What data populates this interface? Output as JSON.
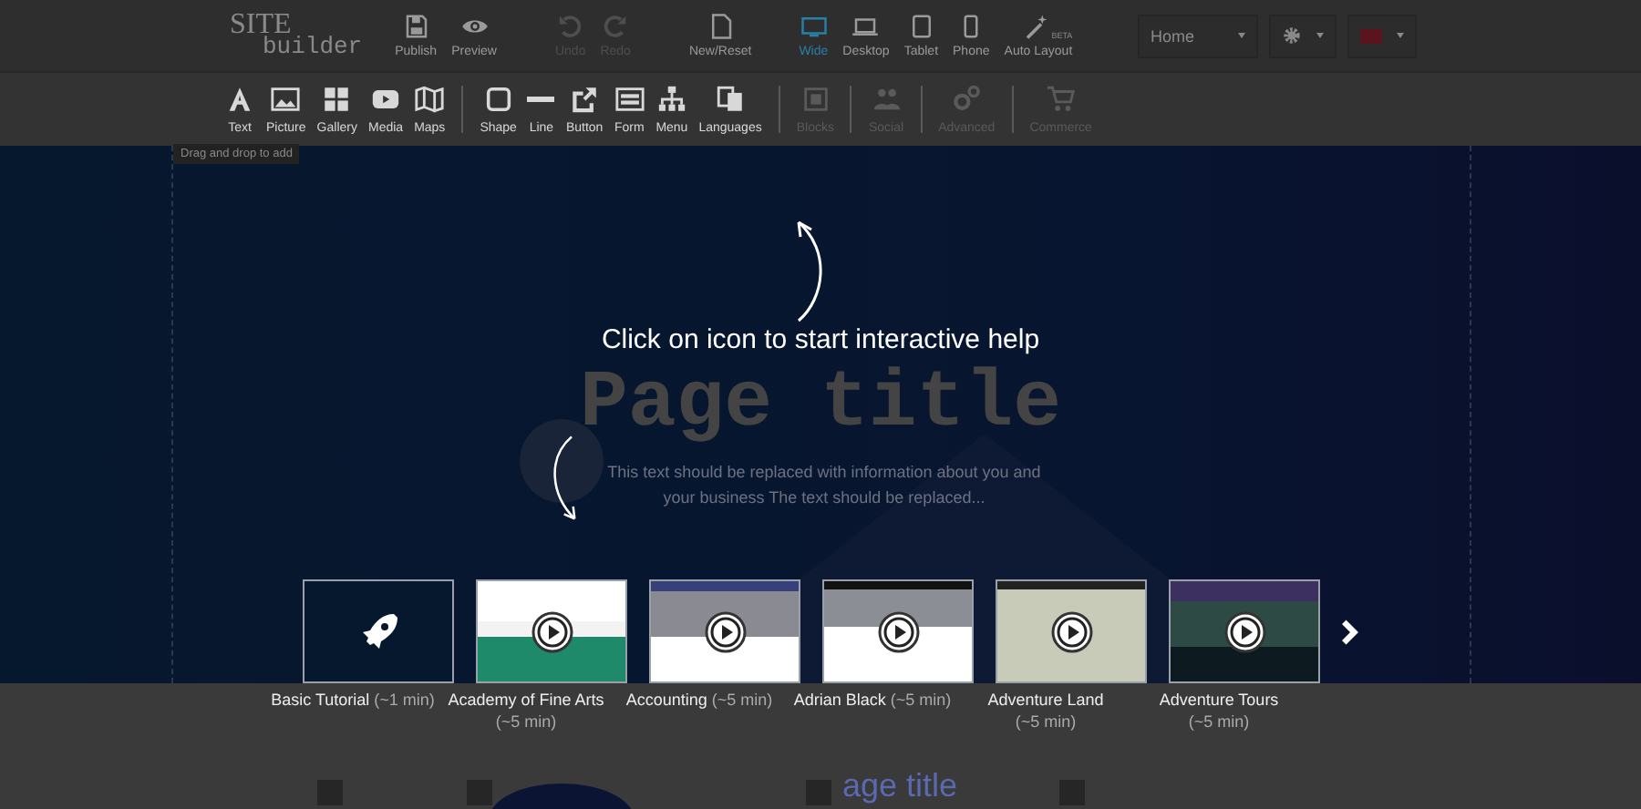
{
  "logo": {
    "line1": "SITE",
    "line2": "builder"
  },
  "top_actions": [
    {
      "label": "Publish",
      "disabled": false
    },
    {
      "label": "Preview",
      "disabled": false
    },
    {
      "label": "Undo",
      "disabled": true
    },
    {
      "label": "Redo",
      "disabled": true
    },
    {
      "label": "New/Reset",
      "disabled": false
    }
  ],
  "view_modes": [
    {
      "label": "Wide",
      "selected": true
    },
    {
      "label": "Desktop",
      "selected": false
    },
    {
      "label": "Tablet",
      "selected": false
    },
    {
      "label": "Phone",
      "selected": false
    }
  ],
  "auto_layout": {
    "label": "Auto Layout",
    "badge": "BETA"
  },
  "page_select": {
    "value": "Home"
  },
  "tool_groups": [
    [
      {
        "label": "Text",
        "disabled": false
      },
      {
        "label": "Picture",
        "disabled": false
      },
      {
        "label": "Gallery",
        "disabled": false
      },
      {
        "label": "Media",
        "disabled": false
      },
      {
        "label": "Maps",
        "disabled": false
      }
    ],
    [
      {
        "label": "Shape",
        "disabled": false
      },
      {
        "label": "Line",
        "disabled": false
      },
      {
        "label": "Button",
        "disabled": false
      },
      {
        "label": "Form",
        "disabled": false
      },
      {
        "label": "Menu",
        "disabled": false
      },
      {
        "label": "Languages",
        "disabled": false
      }
    ],
    [
      {
        "label": "Blocks",
        "disabled": true
      }
    ],
    [
      {
        "label": "Social",
        "disabled": true
      }
    ],
    [
      {
        "label": "Advanced",
        "disabled": true
      }
    ],
    [
      {
        "label": "Commerce",
        "disabled": true
      }
    ]
  ],
  "tooltip": "Drag and drop to add",
  "canvas": {
    "title": "Page title",
    "text": "This text should be replaced with information about you and your business The text should be replaced...",
    "help": "Click on icon to start interactive help"
  },
  "tutorials": [
    {
      "kind": "rocket",
      "title": "Basic Tutorial",
      "duration": "(~1 min)"
    },
    {
      "kind": "video",
      "title": "Academy of Fine Arts",
      "duration": "(~5 min)"
    },
    {
      "kind": "video",
      "title": "Accounting",
      "duration": "(~5 min)"
    },
    {
      "kind": "video",
      "title": "Adrian Black",
      "duration": "(~5 min)"
    },
    {
      "kind": "video",
      "title": "Adventure Land",
      "duration": "(~5 min)"
    },
    {
      "kind": "video",
      "title": "Adventure Tours",
      "duration": "(~5 min)"
    }
  ],
  "below": {
    "title": "age title"
  }
}
